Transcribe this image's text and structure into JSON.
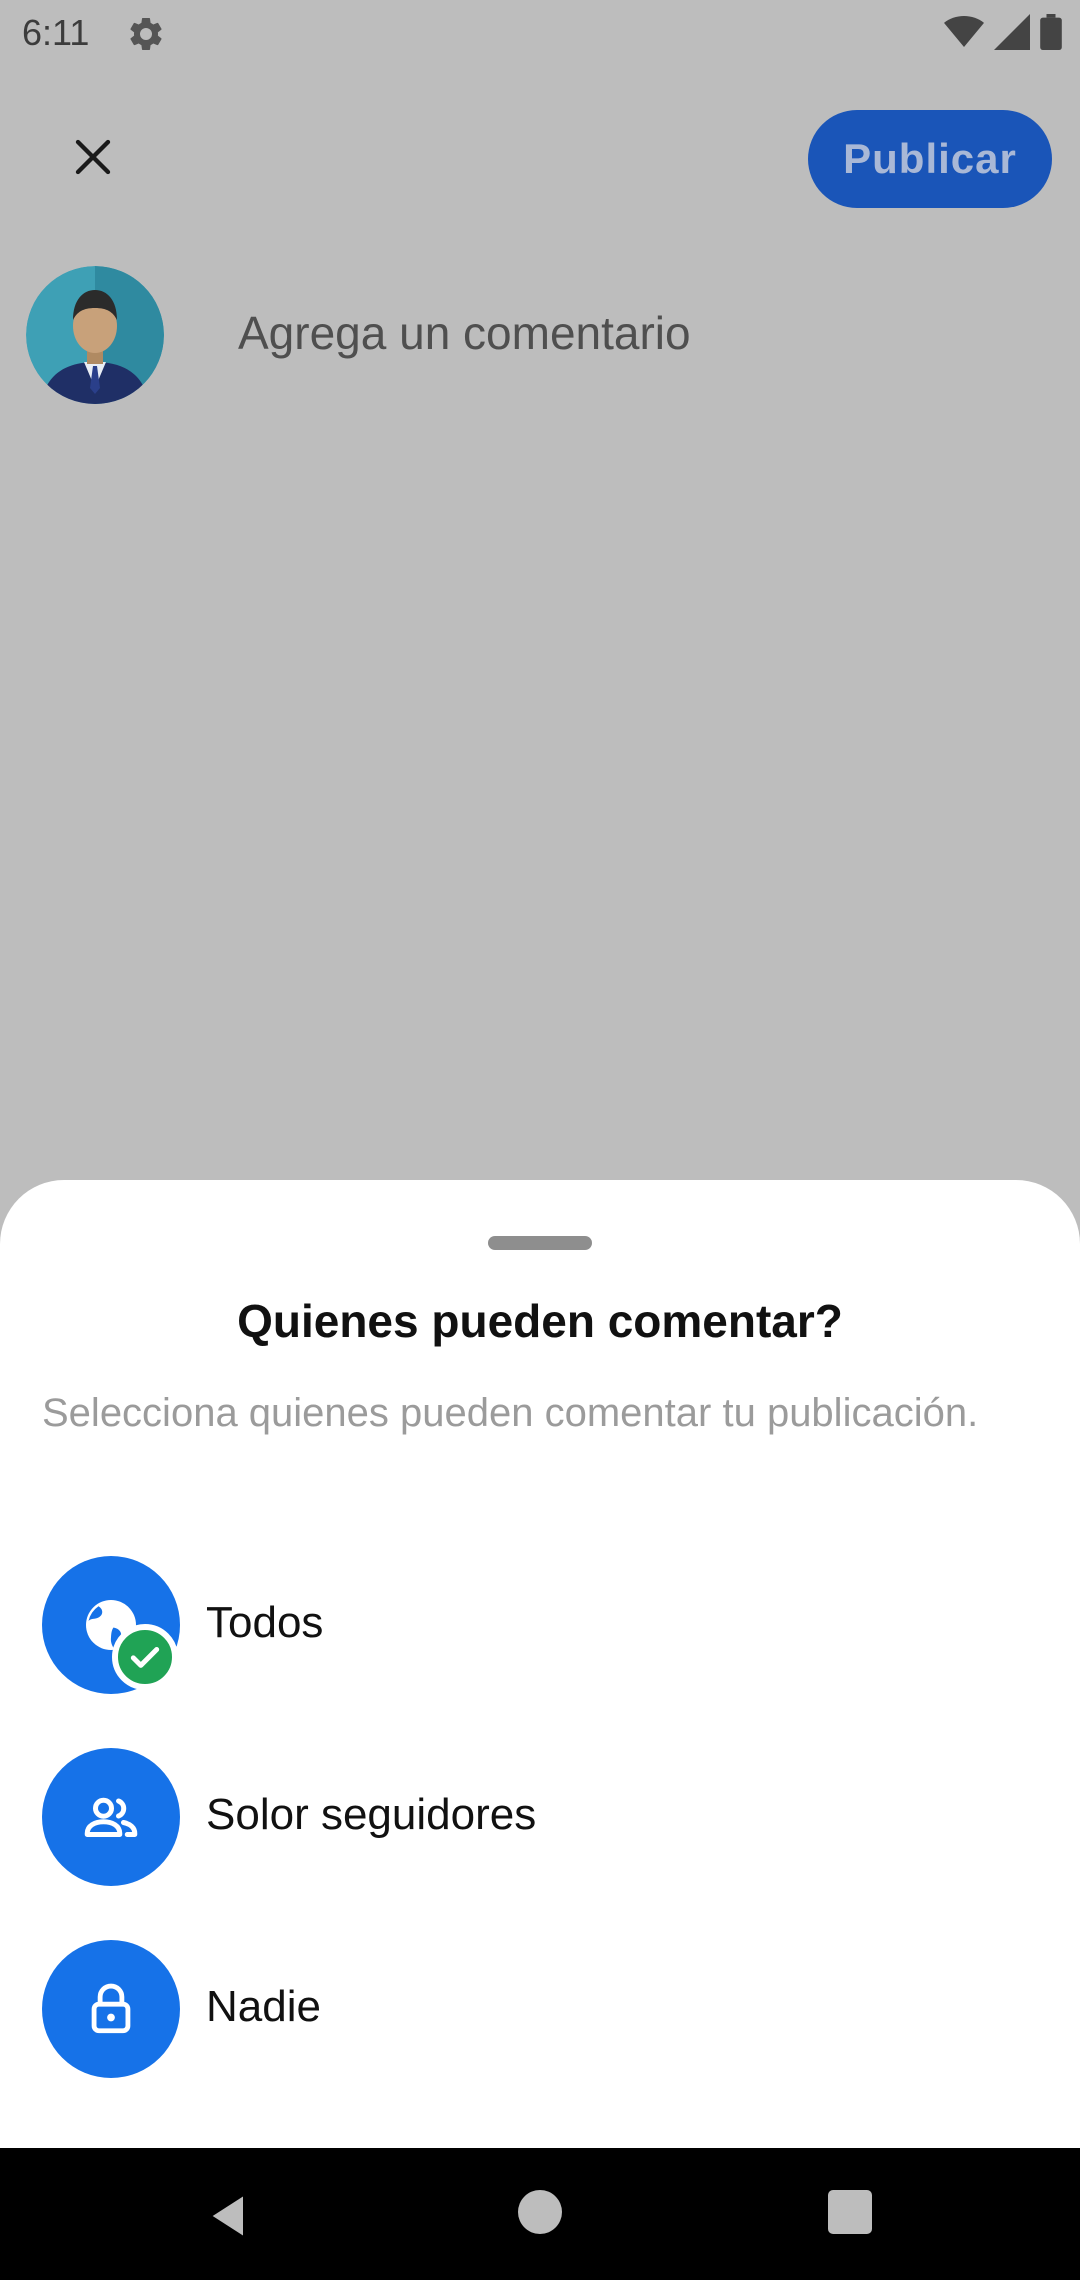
{
  "status_bar": {
    "time": "6:11"
  },
  "header": {
    "publish_label": "Publicar"
  },
  "composer": {
    "placeholder": "Agrega un comentario"
  },
  "sheet": {
    "title": "Quienes pueden comentar?",
    "subtitle": "Selecciona quienes pueden comentar tu publicación.",
    "options": [
      {
        "label": "Todos",
        "icon": "globe-icon",
        "selected": true
      },
      {
        "label": "Solor seguidores",
        "icon": "people-icon",
        "selected": false
      },
      {
        "label": "Nadie",
        "icon": "lock-icon",
        "selected": false
      }
    ]
  },
  "colors": {
    "primary": "#1672e8",
    "publish_button": "#1a55b8",
    "check_badge": "#20a355",
    "dim_background": "#bdbdbd"
  }
}
